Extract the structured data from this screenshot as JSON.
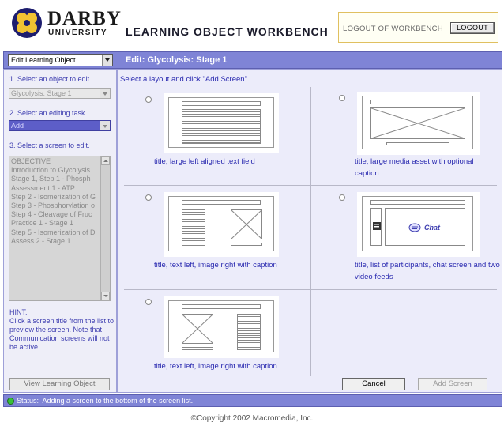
{
  "header": {
    "logo_name": "DARBY",
    "logo_sub": "UNIVERSITY",
    "app_title": "LEARNING OBJECT WORKBENCH",
    "logout_label": "LOGOUT OF WORKBENCH",
    "logout_button": "LOGOUT"
  },
  "topbar": {
    "mode_select": "Edit Learning Object",
    "edit_title": "Edit: Glycolysis: Stage 1"
  },
  "sidebar": {
    "step1": "1. Select an object to edit.",
    "object_value": "Glycolysis: Stage 1",
    "step2": "2. Select an editing task.",
    "task_value": "Add",
    "step3": "3. Select a screen to edit.",
    "screens": [
      "OBJECTIVE",
      "Introduction to Glycolysis",
      "Stage 1, Step 1 -  Phosph",
      "Assessment 1 - ATP",
      "Step 2 - Isomerization of G",
      "Step 3 - Phosphorylation o",
      "Step 4 - Cleavage of Fruc",
      "Practice 1 - Stage 1",
      "Step 5 - Isomerization of D",
      "Assess 2 - Stage 1"
    ],
    "hint_title": "HINT:",
    "hint_text": "Click a screen title from the list to preview the screen. Note that Communication screens will not be active.",
    "view_button": "View Learning Object"
  },
  "main": {
    "instruction": "Select a layout and click \"Add Screen\"",
    "layouts": [
      {
        "caption": "title, large left aligned text field"
      },
      {
        "caption": "title, large media asset with optional caption."
      },
      {
        "caption": "title, text left, image right with caption"
      },
      {
        "caption": "title, list of participants, chat screen and two video feeds",
        "chat_label": "Chat"
      },
      {
        "caption": "title, text left,  image right with caption"
      }
    ],
    "cancel_button": "Cancel",
    "add_button": "Add Screen"
  },
  "status": {
    "label": "Status:",
    "text": "Adding a screen to the bottom of the screen list."
  },
  "footer": {
    "copyright": "©Copyright 2002 Macromedia, Inc."
  },
  "colors": {
    "accent_bar": "#7f84d6",
    "panel_bg": "#ececfa",
    "link_text": "#2a2ab0",
    "status_ok": "#38c038"
  }
}
